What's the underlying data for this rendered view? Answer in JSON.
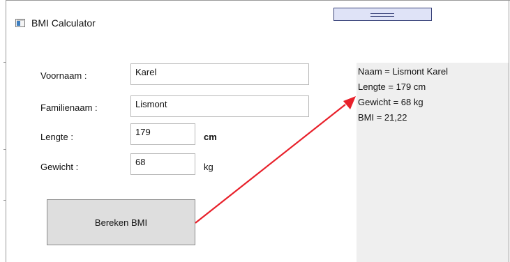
{
  "window": {
    "title": "BMI Calculator"
  },
  "form": {
    "first_name_label": "Voornaam :",
    "first_name_value": "Karel",
    "last_name_label": "Familienaam :",
    "last_name_value": "Lismont",
    "height_label": "Lengte :",
    "height_value": "179",
    "height_unit": "cm",
    "weight_label": "Gewicht :",
    "weight_value": "68",
    "weight_unit": "kg",
    "calculate_label": "Bereken BMI"
  },
  "result": {
    "lines": [
      "Naam = Lismont Karel",
      "Lengte = 179 cm",
      "Gewicht = 68 kg",
      "BMI = 21,22"
    ]
  },
  "colors": {
    "arrow": "#e8202a",
    "panel_bg": "#efefef",
    "button_bg": "#dedede",
    "splitter_border": "#39437a"
  }
}
